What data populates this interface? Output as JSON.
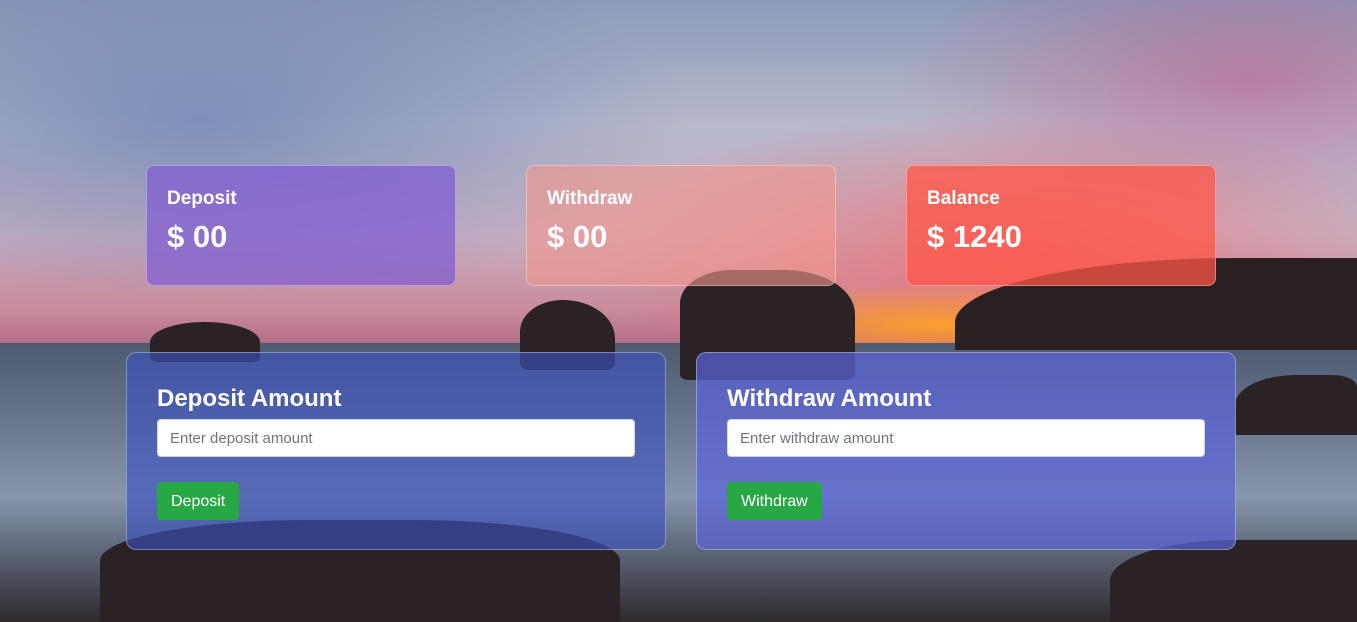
{
  "summary": {
    "deposit": {
      "label": "Deposit",
      "value": "$ 00",
      "color": "#805cd2"
    },
    "withdraw": {
      "label": "Withdraw",
      "value": "$ 00",
      "color": "#f0968c"
    },
    "balance": {
      "label": "Balance",
      "value": "$ 1240",
      "color": "#ff5546"
    }
  },
  "deposit_form": {
    "title": "Deposit Amount",
    "placeholder": "Enter deposit amount",
    "value": "",
    "button_label": "Deposit"
  },
  "withdraw_form": {
    "title": "Withdraw Amount",
    "placeholder": "Enter withdraw amount",
    "value": "",
    "button_label": "Withdraw"
  },
  "colors": {
    "button": "#28a745"
  }
}
